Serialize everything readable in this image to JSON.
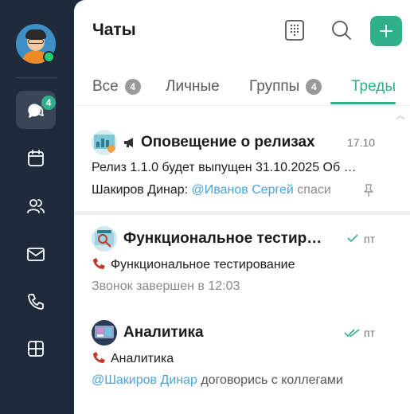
{
  "sidebar": {
    "chats_badge": "4",
    "items": [
      {
        "icon": "chat-bubbles-icon",
        "active": true
      },
      {
        "icon": "calendar-icon"
      },
      {
        "icon": "contacts-icon"
      },
      {
        "icon": "mail-icon"
      },
      {
        "icon": "phone-icon"
      },
      {
        "icon": "apps-grid-icon"
      }
    ]
  },
  "header": {
    "title": "Чаты",
    "icons": [
      "dialpad-icon",
      "search-icon",
      "plus-icon"
    ]
  },
  "tabs": [
    {
      "label": "Все",
      "count": "4"
    },
    {
      "label": "Личные"
    },
    {
      "label": "Группы",
      "count": "4"
    },
    {
      "label": "Треды",
      "active": true
    }
  ],
  "chats": [
    {
      "title": "Оповещение о релизах",
      "title_icon": "megaphone-icon",
      "date": "17.10",
      "preview": "Релиз 1.1.0 будет выпущен 31.10.2025 Об …",
      "author": "Шакиров Динар:",
      "mention": "@Иванов Сергей",
      "text": " спаси",
      "pinned": true
    },
    {
      "title": "Функциональное тестиро…",
      "date": "пт",
      "status": "sent",
      "preview": "Функциональное тестирование",
      "sub": "Звонок завершен в 12:03"
    },
    {
      "title": "Аналитика",
      "date": "пт",
      "status": "read",
      "preview": "Аналитика",
      "mention": "@Шакиров Динар",
      "text": " договорись с коллегами"
    }
  ],
  "colors": {
    "accent": "#2fb08a",
    "sidebar_bg": "#1f2a3a",
    "mention": "#4aa3d9"
  }
}
